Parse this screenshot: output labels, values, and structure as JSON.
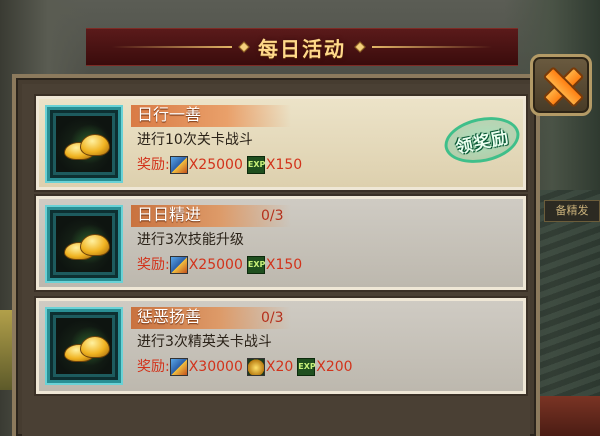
{
  "header": {
    "title": "每日活动"
  },
  "close_button": {
    "icon": "close-x-icon"
  },
  "side_sign": "备精发",
  "tasks": [
    {
      "title": "日行一善",
      "progress": "",
      "description": "进行10次关卡战斗",
      "reward_label": "奖励:",
      "rewards": [
        {
          "icon": "coin-icon",
          "amount": "X25000"
        },
        {
          "icon": "exp-icon",
          "amount": "X150"
        }
      ],
      "claim_label": "领奖励",
      "state": "claimable"
    },
    {
      "title": "日日精进",
      "progress": "0/3",
      "description": "进行3次技能升级",
      "reward_label": "奖励:",
      "rewards": [
        {
          "icon": "coin-icon",
          "amount": "X25000"
        },
        {
          "icon": "exp-icon",
          "amount": "X150"
        }
      ],
      "state": "in-progress"
    },
    {
      "title": "惩恶扬善",
      "progress": "0/3",
      "description": "进行3次精英关卡战斗",
      "reward_label": "奖励:",
      "rewards": [
        {
          "icon": "coin-icon",
          "amount": "X30000"
        },
        {
          "icon": "ingot-icon",
          "amount": "X20"
        },
        {
          "icon": "exp-icon",
          "amount": "X200"
        }
      ],
      "state": "in-progress"
    }
  ],
  "exp_badge_text": "EXP",
  "colors": {
    "title_gold": "#ffd98a",
    "reward_red": "#d2331b",
    "progress_red": "#b5301c",
    "claim_green": "#3fbf8a",
    "close_orange": "#ff9a2a"
  }
}
